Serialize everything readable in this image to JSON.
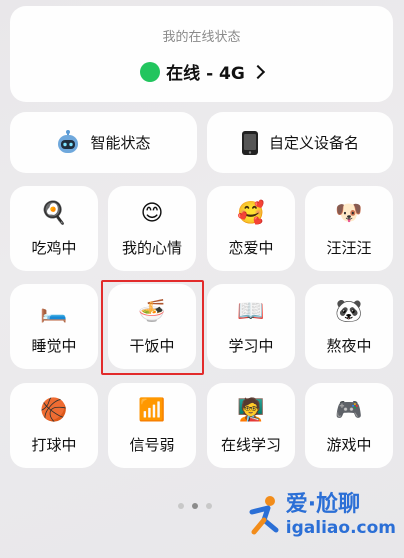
{
  "status": {
    "caption": "我的在线状态",
    "value": "在线 - 4G",
    "dot_color": "#22c55e"
  },
  "wide_buttons": [
    {
      "label": "智能状态",
      "icon": "robot-icon"
    },
    {
      "label": "自定义设备名",
      "icon": "phone-icon"
    }
  ],
  "tiles": [
    {
      "label": "吃鸡中",
      "emoji": "🍳",
      "icon": "chicken-pan-icon"
    },
    {
      "label": "我的心情",
      "emoji": "😊",
      "icon": "mood-icon"
    },
    {
      "label": "恋爱中",
      "emoji": "🥰",
      "icon": "in-love-icon"
    },
    {
      "label": "汪汪汪",
      "emoji": "🐶",
      "icon": "dog-icon"
    },
    {
      "label": "睡觉中",
      "emoji": "🛏️",
      "icon": "bed-icon"
    },
    {
      "label": "干饭中",
      "emoji": "🍜",
      "icon": "noodle-bowl-icon"
    },
    {
      "label": "学习中",
      "emoji": "📖",
      "icon": "book-icon"
    },
    {
      "label": "熬夜中",
      "emoji": "🐼",
      "icon": "panda-icon"
    },
    {
      "label": "打球中",
      "emoji": "🏀",
      "icon": "basketball-icon"
    },
    {
      "label": "信号弱",
      "emoji": "📶",
      "icon": "signal-icon"
    },
    {
      "label": "在线学习",
      "emoji": "🧑‍🏫",
      "icon": "online-study-icon"
    },
    {
      "label": "游戏中",
      "emoji": "🎮",
      "icon": "gamepad-icon"
    }
  ],
  "highlight_color": "#e22b2b",
  "page_indicator": {
    "count": 3,
    "active": 1
  },
  "watermark": {
    "brand": "爱·尬聊",
    "domain": "igaliao.com"
  }
}
